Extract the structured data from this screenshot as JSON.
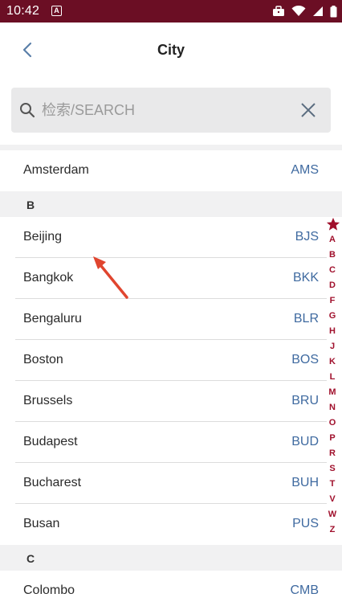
{
  "status_bar": {
    "time": "10:42",
    "notification_letter": "A"
  },
  "nav": {
    "title": "City"
  },
  "search": {
    "placeholder": "检索/SEARCH"
  },
  "sections": {
    "a_first": {
      "name": "Amsterdam",
      "code": "AMS"
    },
    "b_header": "B",
    "b_rows": [
      {
        "name": "Beijing",
        "code": "BJS"
      },
      {
        "name": "Bangkok",
        "code": "BKK"
      },
      {
        "name": "Bengaluru",
        "code": "BLR"
      },
      {
        "name": "Boston",
        "code": "BOS"
      },
      {
        "name": "Brussels",
        "code": "BRU"
      },
      {
        "name": "Budapest",
        "code": "BUD"
      },
      {
        "name": "Bucharest",
        "code": "BUH"
      },
      {
        "name": "Busan",
        "code": "PUS"
      }
    ],
    "c_header": "C",
    "c_rows": [
      {
        "name": "Colombo",
        "code": "CMB"
      }
    ]
  },
  "index_letters": [
    "A",
    "B",
    "C",
    "D",
    "F",
    "G",
    "H",
    "J",
    "K",
    "L",
    "M",
    "N",
    "O",
    "P",
    "R",
    "S",
    "T",
    "V",
    "W",
    "Z"
  ],
  "colors": {
    "status_bar": "#6b0e24",
    "index_accent": "#a0102c",
    "code_text": "#3f6aa0",
    "annotation_arrow": "#e0452f"
  }
}
